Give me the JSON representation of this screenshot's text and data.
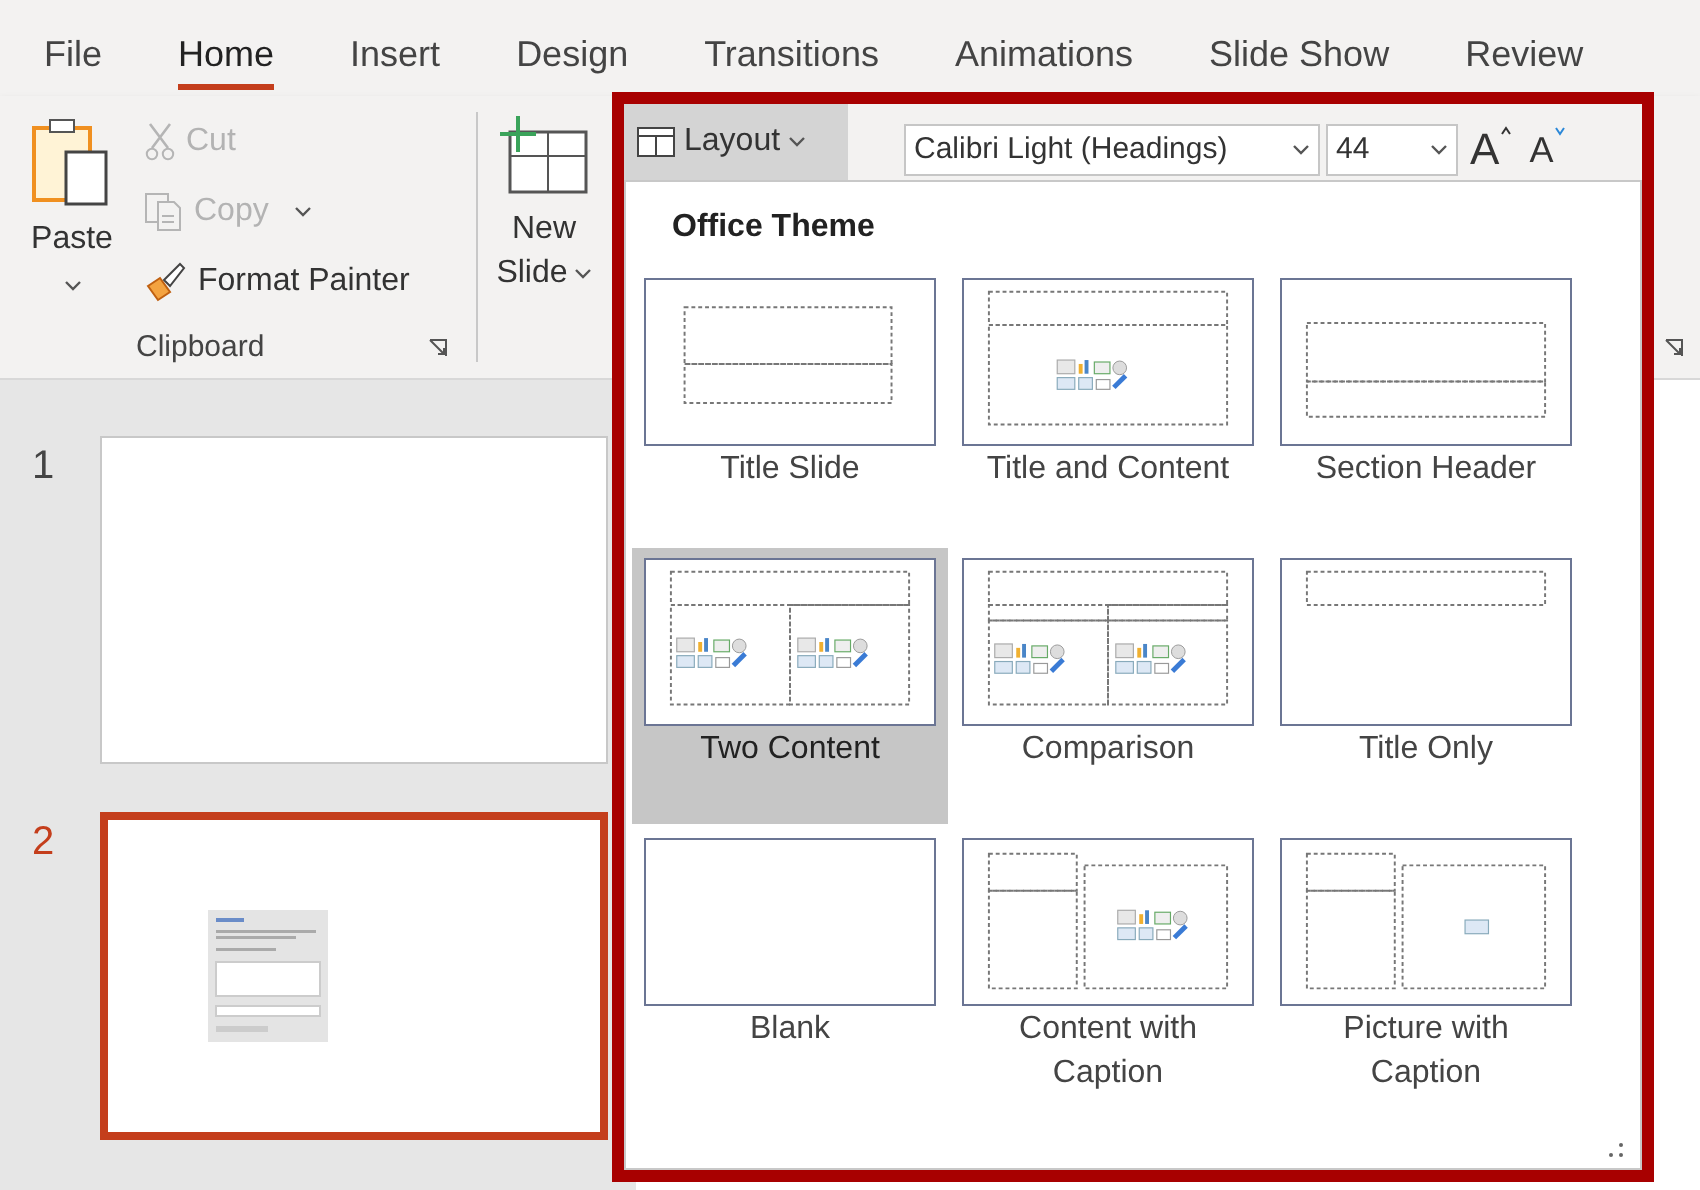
{
  "tabs": [
    {
      "label": "File",
      "selected": false
    },
    {
      "label": "Home",
      "selected": true
    },
    {
      "label": "Insert",
      "selected": false
    },
    {
      "label": "Design",
      "selected": false
    },
    {
      "label": "Transitions",
      "selected": false
    },
    {
      "label": "Animations",
      "selected": false
    },
    {
      "label": "Slide Show",
      "selected": false
    },
    {
      "label": "Review",
      "selected": false
    }
  ],
  "clipboard": {
    "paste": "Paste",
    "items": [
      {
        "label": "Cut",
        "kind": "cut",
        "disabled": true
      },
      {
        "label": "Copy",
        "kind": "copy",
        "disabled": true
      },
      {
        "label": "Format Painter",
        "kind": "painter",
        "disabled": false
      }
    ],
    "group_label": "Clipboard"
  },
  "new_slide": {
    "line_1": "New",
    "line_2": "Slide"
  },
  "layout_button": {
    "label": "Layout"
  },
  "font": {
    "name": "Calibri Light (Headings)",
    "size": "44",
    "grow": "A",
    "shrink": "A"
  },
  "slides": [
    {
      "number": "1",
      "selected": false,
      "kind": "blank"
    },
    {
      "number": "2",
      "selected": true,
      "kind": "dialog"
    }
  ],
  "layout_gallery": {
    "heading": "Office Theme",
    "layouts": [
      {
        "label": "Title Slide",
        "kind": "title_slide",
        "selected": false
      },
      {
        "label": "Title and Content",
        "kind": "title_content",
        "selected": false
      },
      {
        "label": "Section Header",
        "kind": "section_header",
        "selected": false
      },
      {
        "label": "Two Content",
        "kind": "two_content",
        "selected": true
      },
      {
        "label": "Comparison",
        "kind": "comparison",
        "selected": false
      },
      {
        "label": "Title Only",
        "kind": "title_only",
        "selected": false
      },
      {
        "label": "Blank",
        "kind": "blank",
        "selected": false
      },
      {
        "label": "Content with\nCaption",
        "kind": "content_caption",
        "selected": false
      },
      {
        "label": "Picture with\nCaption",
        "kind": "picture_caption",
        "selected": false
      }
    ]
  }
}
